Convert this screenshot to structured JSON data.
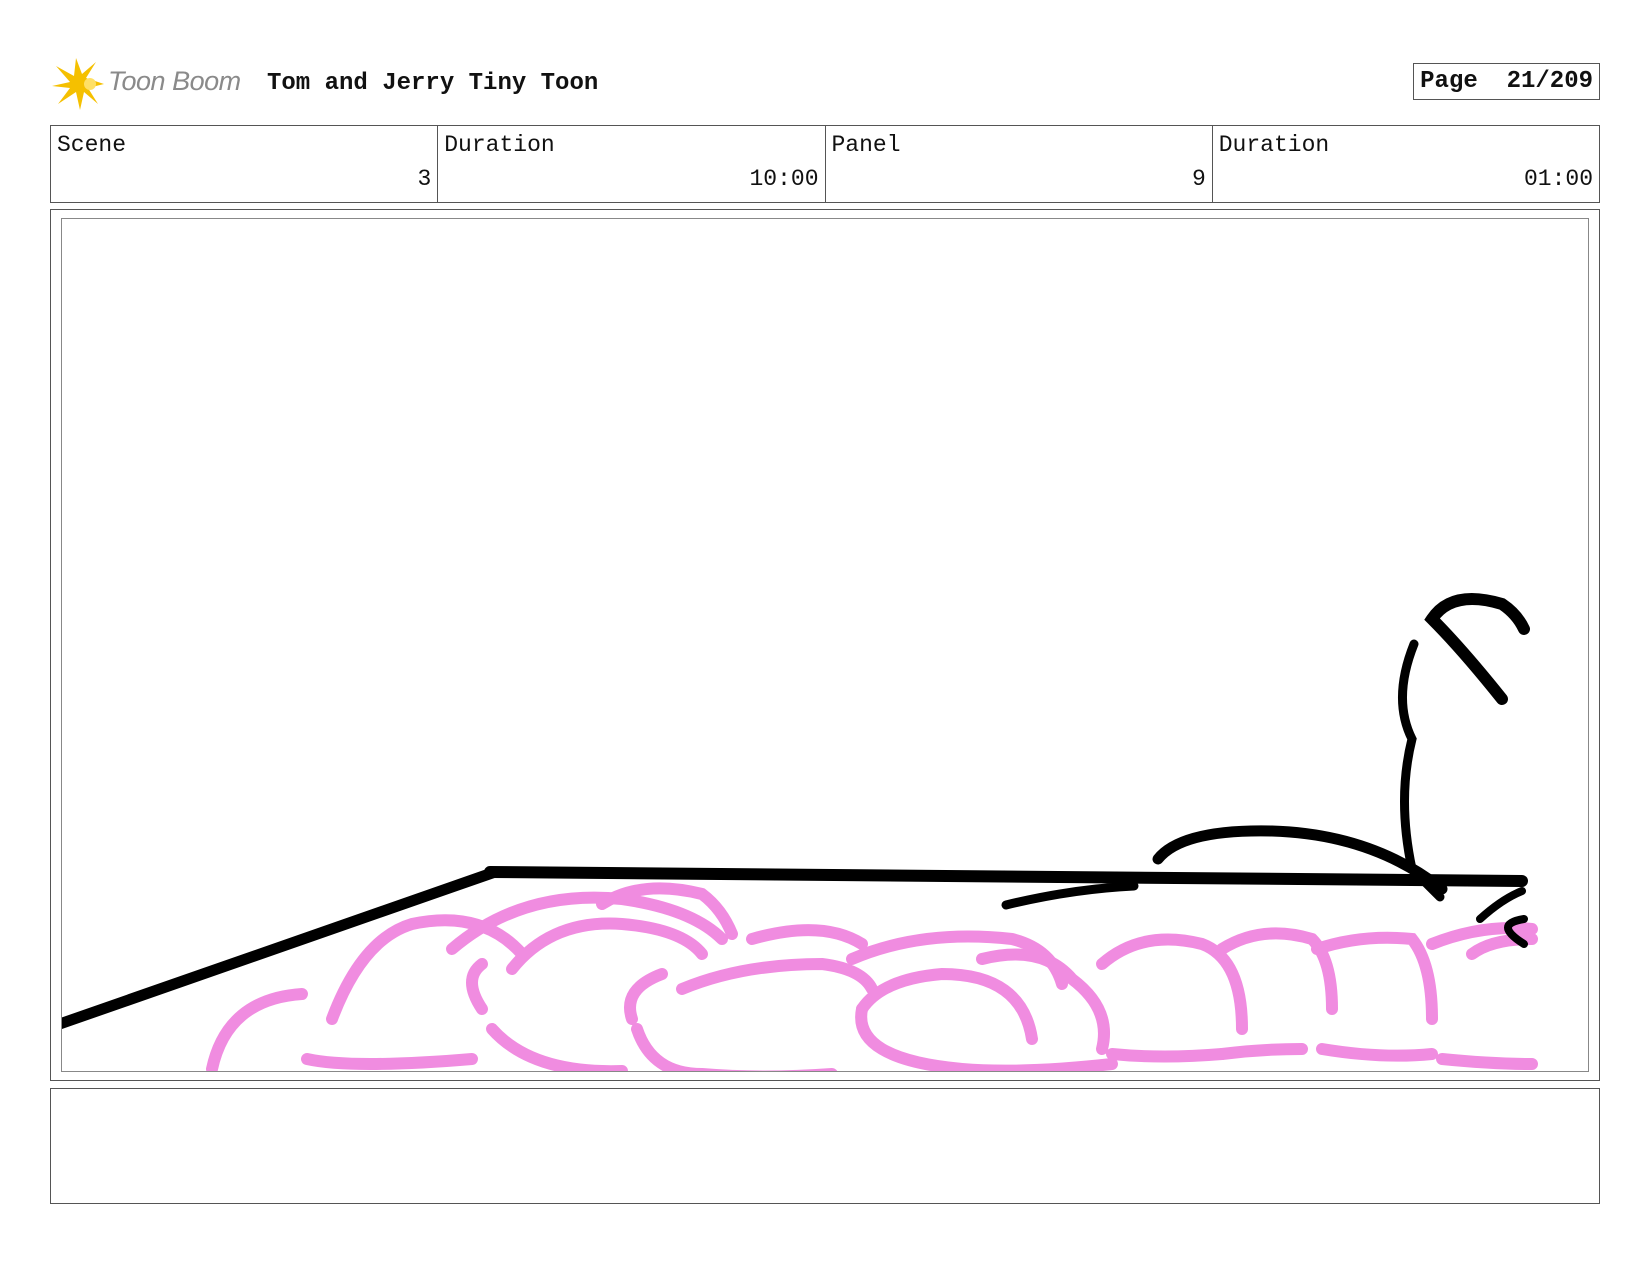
{
  "header": {
    "logo_text": "Toon Boom",
    "project_title": "Tom and Jerry Tiny Toon",
    "page_label": "Page",
    "page_number": "21/209"
  },
  "info": {
    "scene_label": "Scene",
    "scene_value": "3",
    "scene_duration_label": "Duration",
    "scene_duration_value": "10:00",
    "panel_label": "Panel",
    "panel_value": "9",
    "panel_duration_label": "Duration",
    "panel_duration_value": "01:00"
  },
  "colors": {
    "logo_star": "#f5c000",
    "sketch_pink": "#f08ce0",
    "sketch_black": "#000000"
  },
  "notes": {
    "text": ""
  }
}
